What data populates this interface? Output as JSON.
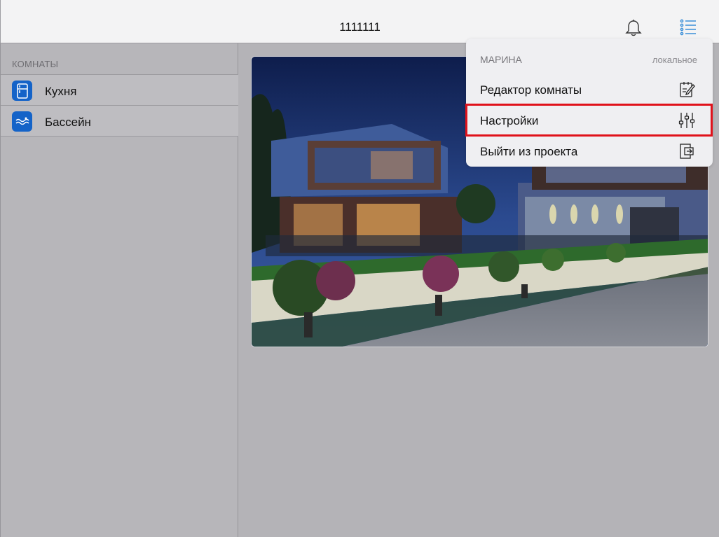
{
  "header": {
    "title": "1111111",
    "bell_icon": "bell-icon",
    "menu_icon": "list-menu-icon"
  },
  "sidebar": {
    "section_title": "КОМНАТЫ",
    "rooms": [
      {
        "label": "Кухня",
        "icon": "fridge-icon"
      },
      {
        "label": "Бассейн",
        "icon": "pool-waves-icon"
      }
    ]
  },
  "main": {
    "image": "modern-house-night-photo"
  },
  "popover": {
    "user_name": "МАРИНА",
    "mode": "локальное",
    "items": [
      {
        "label": "Редактор комнаты",
        "icon": "edit-document-icon"
      },
      {
        "label": "Настройки",
        "icon": "sliders-icon"
      },
      {
        "label": "Выйти из проекта",
        "icon": "exit-icon"
      }
    ]
  },
  "colors": {
    "accent_blue": "#1463c8",
    "highlight_red": "#e0121b",
    "icon_blue": "#3b8fd8"
  }
}
